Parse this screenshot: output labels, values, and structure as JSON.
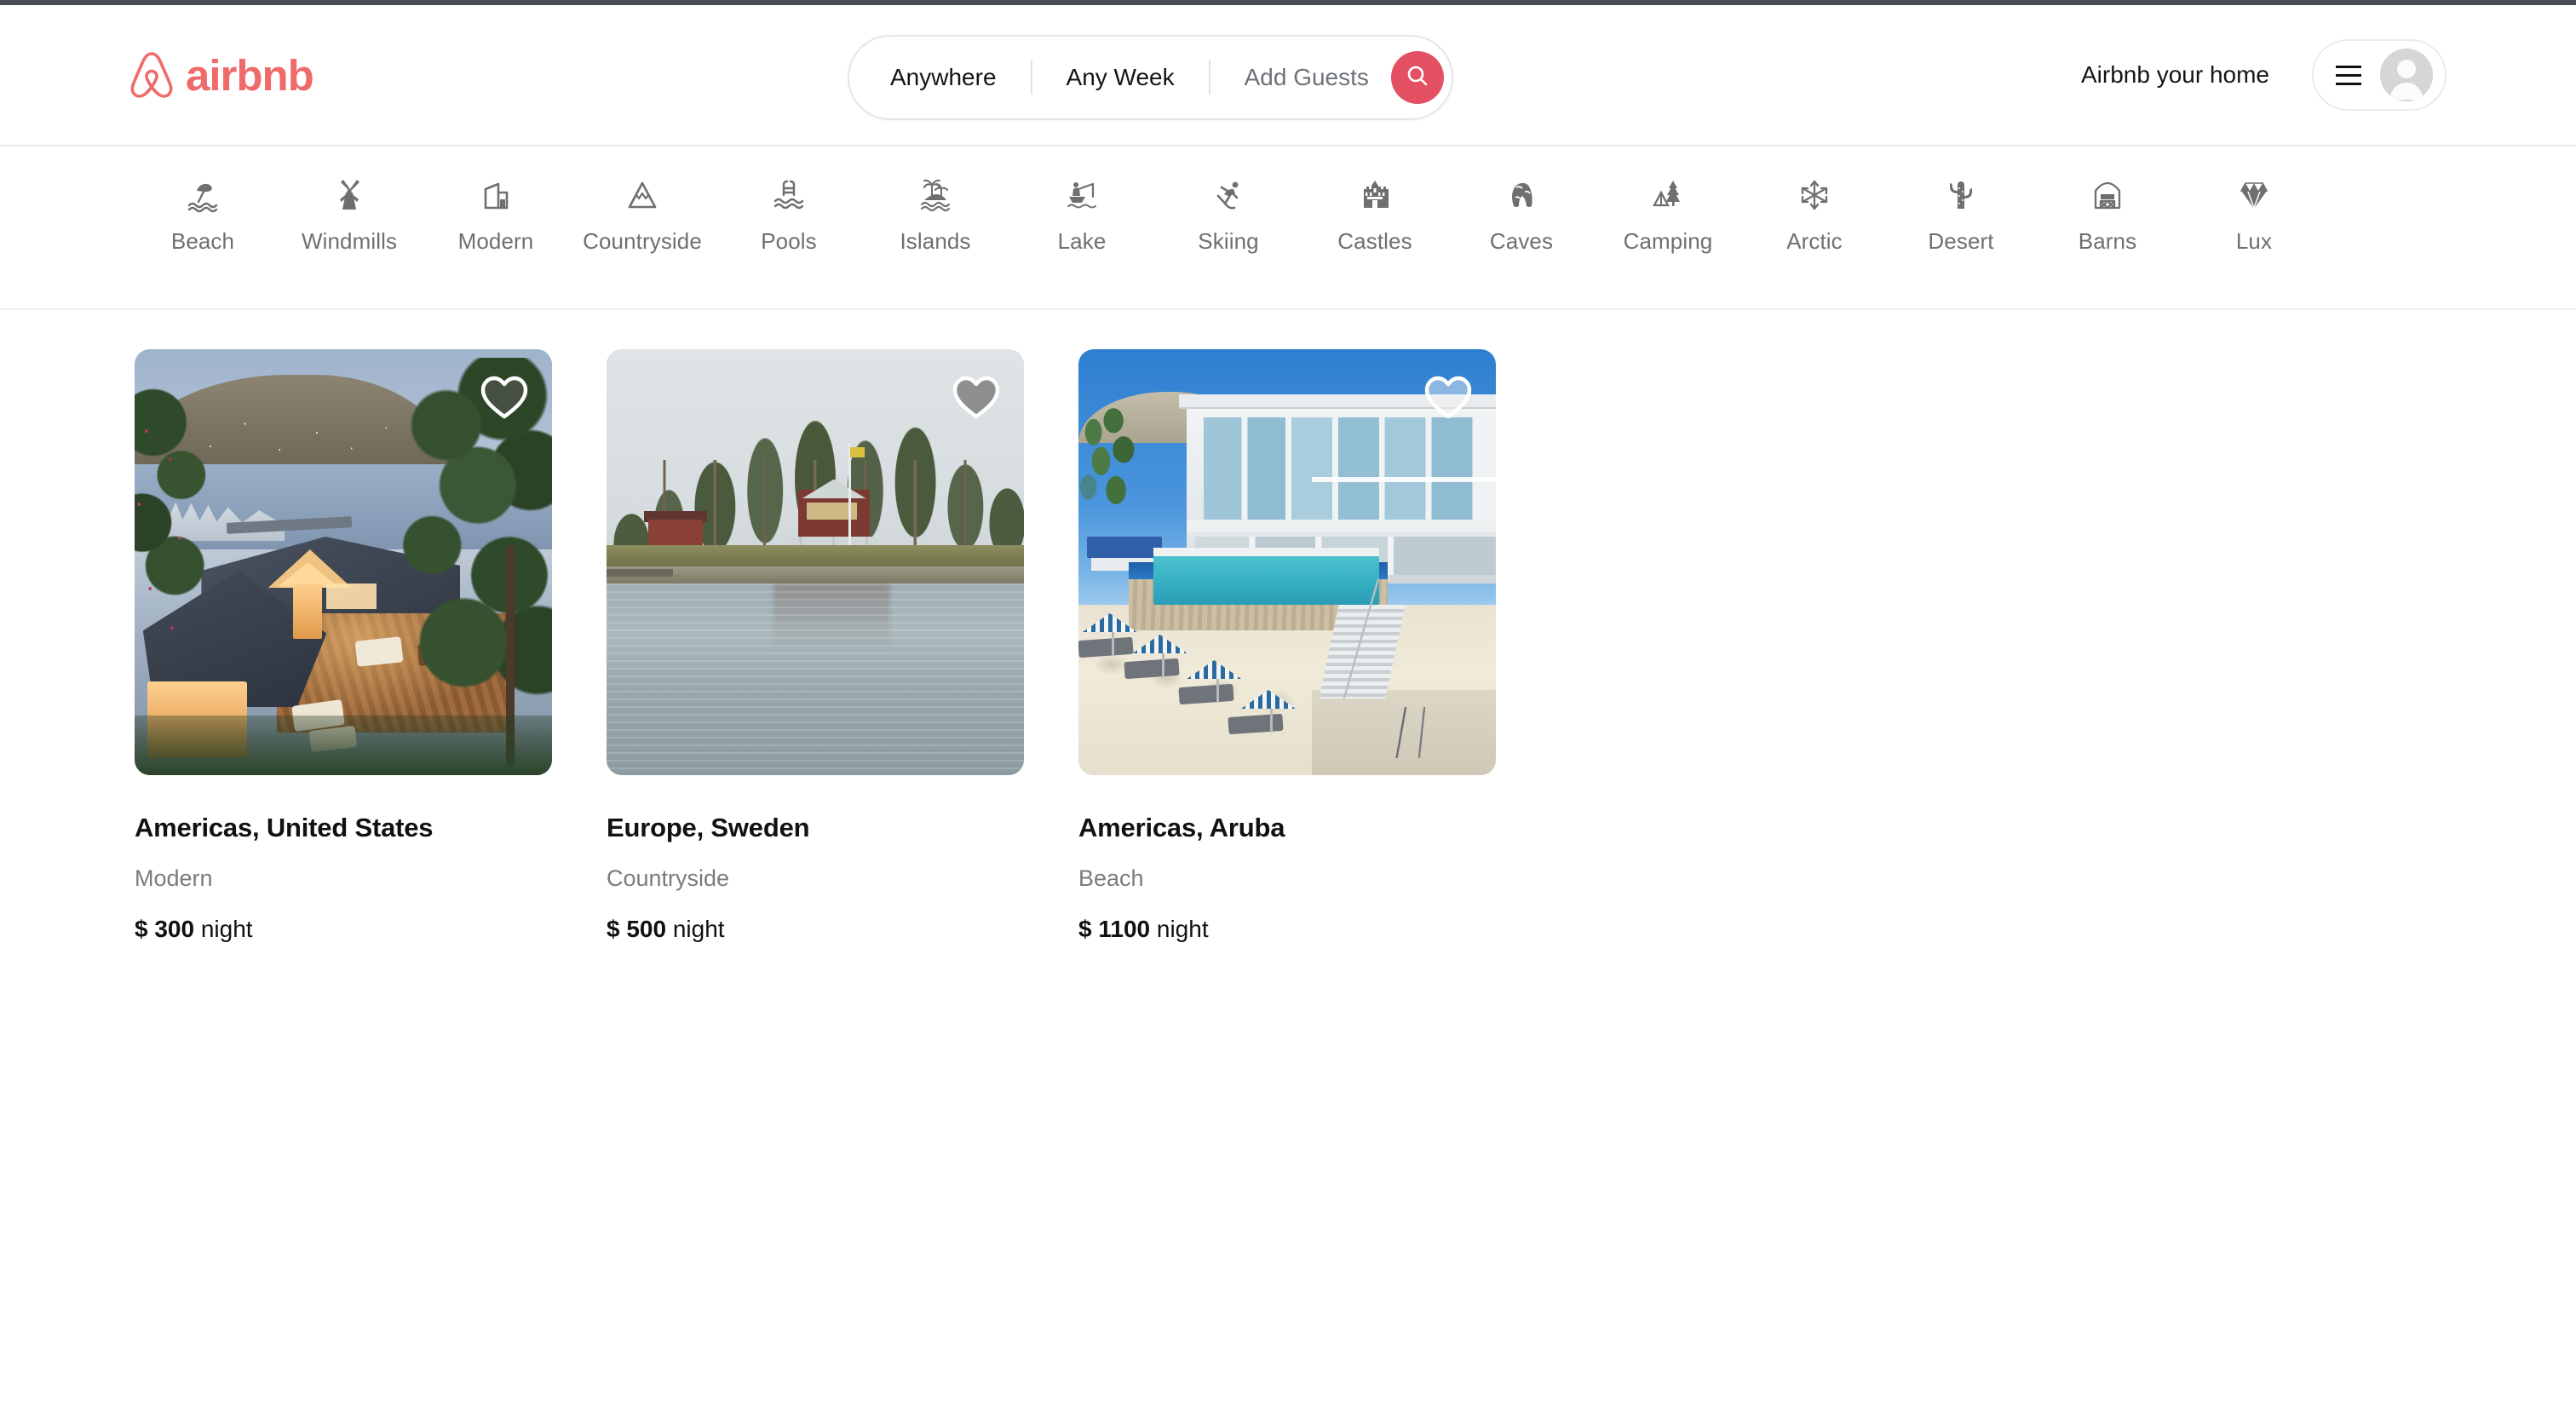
{
  "brand": {
    "name": "airbnb",
    "logo_icon": "airbnb-belo-icon",
    "accent_color": "#ef6a6a",
    "search_button_color": "#e34f63"
  },
  "search": {
    "location": "Anywhere",
    "dates": "Any Week",
    "guests": "Add Guests",
    "search_icon": "search-icon"
  },
  "header": {
    "host_link": "Airbnb your home",
    "menu_icon": "hamburger-menu-icon",
    "avatar_icon": "user-avatar-icon"
  },
  "categories": [
    {
      "label": "Beach",
      "icon": "beach-umbrella-icon"
    },
    {
      "label": "Windmills",
      "icon": "windmill-icon"
    },
    {
      "label": "Modern",
      "icon": "modern-building-icon"
    },
    {
      "label": "Countryside",
      "icon": "mountain-icon"
    },
    {
      "label": "Pools",
      "icon": "pool-ladder-icon"
    },
    {
      "label": "Islands",
      "icon": "palm-island-icon"
    },
    {
      "label": "Lake",
      "icon": "fishing-boat-icon"
    },
    {
      "label": "Skiing",
      "icon": "skier-icon"
    },
    {
      "label": "Castles",
      "icon": "castle-icon"
    },
    {
      "label": "Caves",
      "icon": "cave-icon"
    },
    {
      "label": "Camping",
      "icon": "tent-tree-icon"
    },
    {
      "label": "Arctic",
      "icon": "snowflake-icon"
    },
    {
      "label": "Desert",
      "icon": "cactus-icon"
    },
    {
      "label": "Barns",
      "icon": "barn-icon"
    },
    {
      "label": "Lux",
      "icon": "diamond-icon"
    }
  ],
  "listings": [
    {
      "title": "Americas, United States",
      "category": "Modern",
      "currency": "$",
      "price": "300",
      "price_unit": "night",
      "favorite_icon": "heart-icon",
      "image_alt": "Dusk waterfront modern house with wooden deck overlooking a marina"
    },
    {
      "title": "Europe, Sweden",
      "category": "Countryside",
      "currency": "$",
      "price": "500",
      "price_unit": "night",
      "favorite_icon": "heart-icon",
      "image_alt": "Red Swedish cabin among pine trees on a lake shore"
    },
    {
      "title": "Americas, Aruba",
      "category": "Beach",
      "currency": "$",
      "price": "1100",
      "price_unit": "night",
      "favorite_icon": "heart-icon",
      "image_alt": "White modern beach villa with infinity pool and striped umbrellas"
    }
  ]
}
